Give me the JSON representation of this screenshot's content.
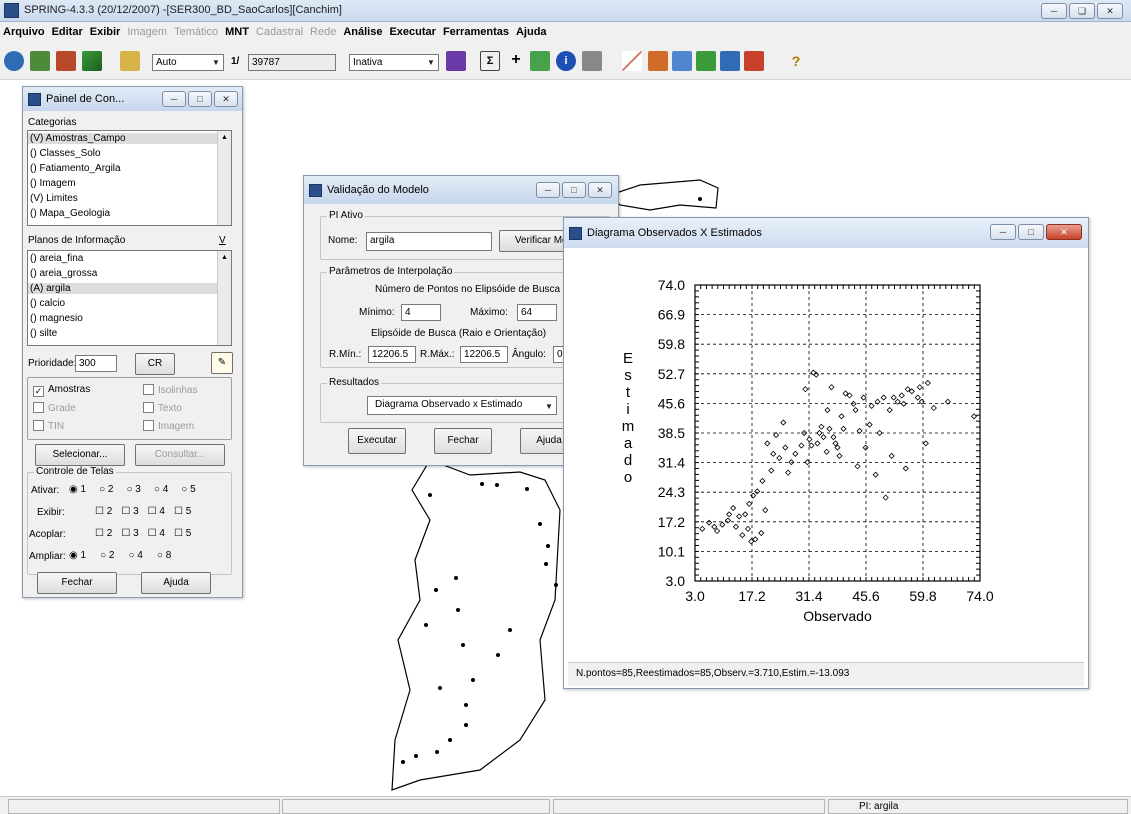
{
  "app": {
    "title": "SPRING-4.3.3 (20/12/2007) -[SER300_BD_SaoCarlos][Canchim]"
  },
  "menu": [
    {
      "label": "Arquivo",
      "state": "bold"
    },
    {
      "label": "Editar",
      "state": "bold"
    },
    {
      "label": "Exibir",
      "state": "bold"
    },
    {
      "label": "Imagem",
      "state": "disabled"
    },
    {
      "label": "Temático",
      "state": "disabled"
    },
    {
      "label": "MNT",
      "state": "bold"
    },
    {
      "label": "Cadastral",
      "state": "disabled"
    },
    {
      "label": "Rede",
      "state": "disabled"
    },
    {
      "label": "Análise",
      "state": "bold"
    },
    {
      "label": "Executar",
      "state": "bold"
    },
    {
      "label": "Ferramentas",
      "state": "bold"
    },
    {
      "label": "Ajuda",
      "state": "bold"
    }
  ],
  "toolbar": {
    "zoom_mode": "Auto",
    "scale_prefix": "1/",
    "scale_value": "39787",
    "status_select": "Inativa"
  },
  "control_panel": {
    "title": "Painel de Con...",
    "categories_label": "Categorias",
    "categories": [
      "(V) Amostras_Campo",
      "() Classes_Solo",
      "() Fatiamento_Argila",
      "() Imagem",
      "(V) Limites",
      "() Mapa_Geologia"
    ],
    "planes_label": "Planos de Informação",
    "planes_v": "V",
    "planes": [
      "() areia_fina",
      "() areia_grossa",
      "(A) argila",
      "() calcio",
      "() magnesio",
      "() silte"
    ],
    "priority_label": "Prioridade:",
    "priority_value": "300",
    "cr_label": "CR",
    "representations": [
      {
        "label": "Amostras",
        "checked": true,
        "enabled": true
      },
      {
        "label": "Isolinhas",
        "checked": false,
        "enabled": false
      },
      {
        "label": "Grade",
        "checked": false,
        "enabled": false
      },
      {
        "label": "Texto",
        "checked": false,
        "enabled": false
      },
      {
        "label": "TIN",
        "checked": false,
        "enabled": false
      },
      {
        "label": "Imagem",
        "checked": false,
        "enabled": false
      }
    ],
    "select_label": "Selecionar...",
    "query_label": "Consultar...",
    "screens_label": "Controle de Telas",
    "activate_label": "Ativar:",
    "show_label": "Exibir:",
    "couple_label": "Acoplar:",
    "zoom_label": "Ampliar:",
    "activate_options": [
      "1",
      "2",
      "3",
      "4",
      "5"
    ],
    "show_options": [
      "2",
      "3",
      "4",
      "5"
    ],
    "couple_options": [
      "2",
      "3",
      "4",
      "5"
    ],
    "zoom_options": [
      "1",
      "2",
      "4",
      "8"
    ],
    "close_label": "Fechar",
    "help_label": "Ajuda"
  },
  "validation": {
    "title": "Validação do Modelo",
    "pi_group": "PI Ativo",
    "name_label": "Nome:",
    "name_value": "argila",
    "verify_label": "Verificar Mod",
    "params_group": "Parâmetros de Interpolação",
    "points_label": "Número de Pontos no Elipsóide de Busca",
    "min_label": "Mínimo:",
    "min_value": "4",
    "max_label": "Máximo:",
    "max_value": "64",
    "ellipse_label": "Elipsóide de Busca (Raio e Orientação)",
    "rmin_label": "R.Mín.:",
    "rmin_value": "12206.5",
    "rmax_label": "R.Máx.:",
    "rmax_value": "12206.5",
    "angle_label": "Ângulo:",
    "angle_value": "0",
    "results_group": "Resultados",
    "results_value": "Diagrama Observado x Estimado",
    "execute_label": "Executar",
    "close_label": "Fechar",
    "help_label": "Ajuda"
  },
  "diagram": {
    "title": "Diagrama Observados X Estimados",
    "status_text": "N.pontos=85,Reestimados=85,Observ.=3.710,Estim.=-13.093"
  },
  "chart_data": {
    "type": "scatter",
    "title": "",
    "xlabel": "Observado",
    "ylabel": "Estimado",
    "xlim": [
      3.0,
      74.0
    ],
    "ylim": [
      3.0,
      74.0
    ],
    "xticks": [
      "3.0",
      "17.2",
      "31.4",
      "45.6",
      "59.8",
      "74.0"
    ],
    "yticks": [
      "3.0",
      "10.1",
      "17.2",
      "24.3",
      "31.4",
      "38.5",
      "45.6",
      "52.7",
      "59.8",
      "66.9",
      "74.0"
    ],
    "grid": true,
    "points": [
      [
        4.8,
        15.5
      ],
      [
        6.5,
        17.0
      ],
      [
        7.8,
        16.0
      ],
      [
        8.5,
        15.0
      ],
      [
        9.8,
        16.5
      ],
      [
        11.2,
        17.5
      ],
      [
        12.5,
        20.5
      ],
      [
        11.5,
        19.0
      ],
      [
        13.2,
        16.0
      ],
      [
        14.8,
        14.0
      ],
      [
        15.5,
        19.0
      ],
      [
        16.2,
        15.5
      ],
      [
        17.0,
        12.5
      ],
      [
        18.0,
        13.0
      ],
      [
        19.5,
        14.5
      ],
      [
        20.5,
        20.0
      ],
      [
        14.0,
        18.5
      ],
      [
        16.5,
        21.5
      ],
      [
        17.5,
        23.5
      ],
      [
        18.5,
        24.5
      ],
      [
        19.8,
        27.0
      ],
      [
        21.0,
        36.0
      ],
      [
        22.5,
        33.5
      ],
      [
        22.0,
        29.5
      ],
      [
        23.2,
        38.0
      ],
      [
        24.0,
        32.5
      ],
      [
        25.5,
        35.0
      ],
      [
        26.2,
        29.0
      ],
      [
        25.0,
        41.0
      ],
      [
        27.0,
        31.5
      ],
      [
        28.0,
        33.5
      ],
      [
        29.5,
        35.5
      ],
      [
        30.2,
        38.5
      ],
      [
        30.5,
        49.0
      ],
      [
        31.5,
        37.0
      ],
      [
        32.0,
        35.5
      ],
      [
        32.5,
        53.0
      ],
      [
        33.5,
        36.0
      ],
      [
        34.0,
        38.5
      ],
      [
        34.5,
        40.0
      ],
      [
        35.0,
        37.5
      ],
      [
        35.8,
        34.0
      ],
      [
        36.5,
        39.5
      ],
      [
        37.5,
        37.5
      ],
      [
        38.0,
        36.0
      ],
      [
        33.2,
        52.5
      ],
      [
        31.0,
        31.5
      ],
      [
        36.0,
        44.0
      ],
      [
        37.0,
        49.5
      ],
      [
        38.5,
        35.0
      ],
      [
        39.0,
        33.0
      ],
      [
        39.5,
        42.5
      ],
      [
        40.0,
        39.5
      ],
      [
        40.5,
        48.0
      ],
      [
        41.5,
        47.5
      ],
      [
        42.5,
        45.5
      ],
      [
        43.0,
        44.0
      ],
      [
        44.0,
        39.0
      ],
      [
        43.5,
        30.5
      ],
      [
        45.0,
        47.0
      ],
      [
        45.5,
        35.0
      ],
      [
        47.0,
        45.0
      ],
      [
        48.5,
        46.0
      ],
      [
        49.0,
        38.5
      ],
      [
        50.0,
        47.0
      ],
      [
        50.5,
        23.0
      ],
      [
        51.5,
        44.0
      ],
      [
        52.5,
        47.0
      ],
      [
        53.5,
        46.0
      ],
      [
        54.5,
        47.5
      ],
      [
        55.0,
        45.5
      ],
      [
        56.0,
        49.0
      ],
      [
        57.0,
        48.5
      ],
      [
        58.5,
        47.0
      ],
      [
        59.5,
        46.0
      ],
      [
        59.0,
        49.5
      ],
      [
        61.0,
        50.5
      ],
      [
        62.5,
        44.5
      ],
      [
        48.0,
        28.5
      ],
      [
        52.0,
        33.0
      ],
      [
        60.5,
        36.0
      ],
      [
        55.5,
        30.0
      ],
      [
        46.5,
        40.5
      ],
      [
        66.0,
        46.0
      ],
      [
        72.5,
        42.5
      ]
    ]
  },
  "statusbar": {
    "pi": "PI: argila"
  }
}
